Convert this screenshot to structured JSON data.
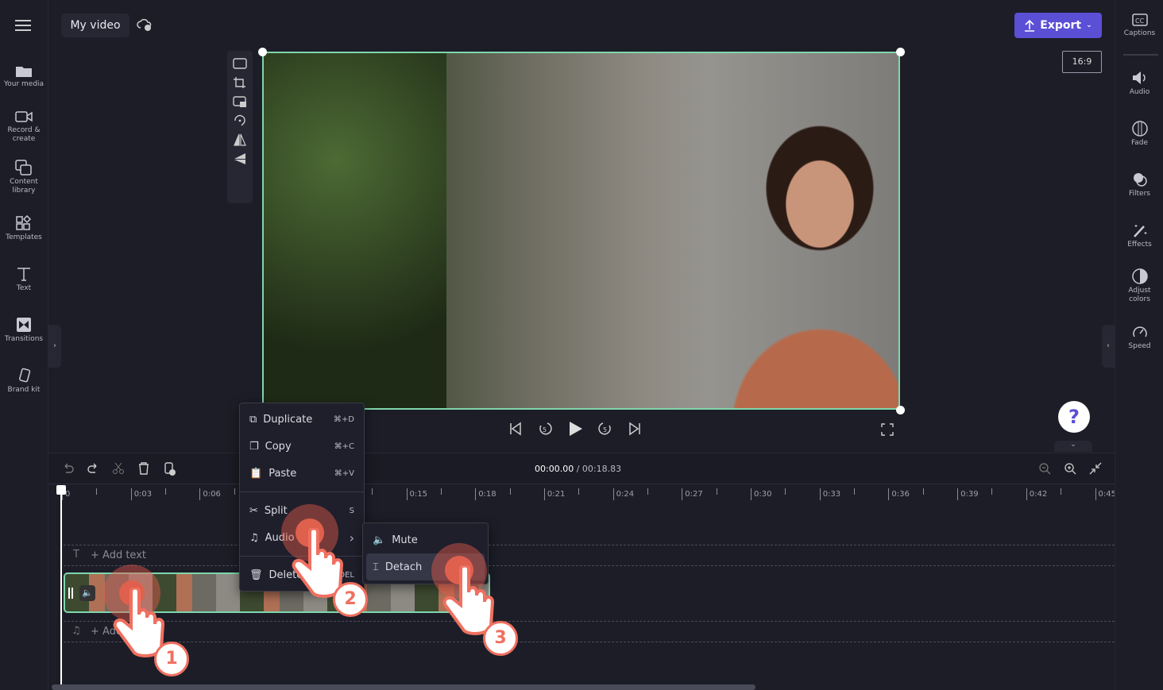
{
  "app": {
    "project_title": "My video",
    "export_label": "Export",
    "aspect_ratio": "16:9",
    "accent": "#5b4fd6",
    "selection_color": "#7fd6ad"
  },
  "left_nav": [
    {
      "label": "Your media",
      "icon": "folder-icon"
    },
    {
      "label": "Record &\ncreate",
      "icon": "camera-icon"
    },
    {
      "label": "Content\nlibrary",
      "icon": "library-icon"
    },
    {
      "label": "Templates",
      "icon": "templates-icon"
    },
    {
      "label": "Text",
      "icon": "text-icon"
    },
    {
      "label": "Transitions",
      "icon": "transitions-icon"
    },
    {
      "label": "Brand kit",
      "icon": "brand-kit-icon"
    }
  ],
  "right_nav": [
    {
      "label": "Captions",
      "icon": "captions-icon"
    },
    {
      "label": "Audio",
      "icon": "speaker-icon"
    },
    {
      "label": "Fade",
      "icon": "fade-icon"
    },
    {
      "label": "Filters",
      "icon": "filters-icon"
    },
    {
      "label": "Effects",
      "icon": "magic-wand-icon"
    },
    {
      "label": "Adjust\ncolors",
      "icon": "contrast-icon"
    },
    {
      "label": "Speed",
      "icon": "speedometer-icon"
    }
  ],
  "playback": {
    "current": "00:00.00",
    "total": "/ 00:18.83"
  },
  "help": "?",
  "ruler": [
    "0",
    "0:03",
    "0:06",
    "0:09",
    "0:12",
    "0:15",
    "0:18",
    "0:21",
    "0:24",
    "0:27",
    "0:30",
    "0:33",
    "0:36",
    "0:39",
    "0:42",
    "0:45"
  ],
  "tracks": {
    "text": "+ Add text",
    "audio": "+ Add audio"
  },
  "context_menu": [
    {
      "label": "Duplicate",
      "shortcut": "⌘+D"
    },
    {
      "label": "Copy",
      "shortcut": "⌘+C"
    },
    {
      "label": "Paste",
      "shortcut": "⌘+V"
    },
    {
      "label": "Split",
      "shortcut": "S"
    },
    {
      "label": "Audio",
      "shortcut": "›"
    },
    {
      "label": "Delete",
      "shortcut": "DEL"
    }
  ],
  "submenu": [
    {
      "label": "Mute"
    },
    {
      "label": "Detach"
    }
  ],
  "steps": [
    "1",
    "2",
    "3"
  ]
}
